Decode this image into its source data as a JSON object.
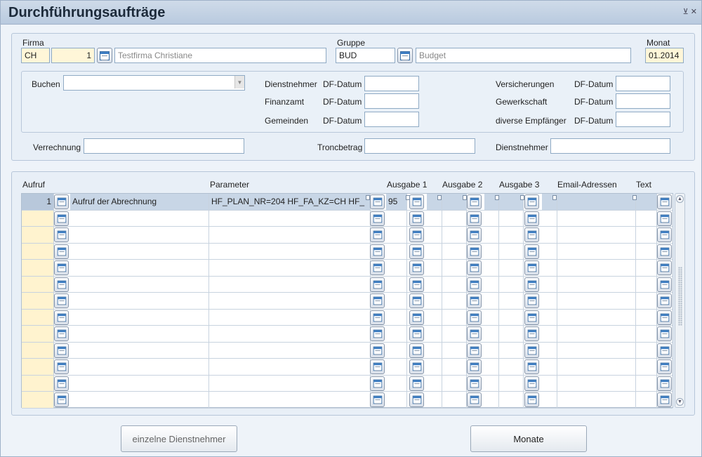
{
  "window": {
    "title": "Durchführungsaufträge",
    "controls": "⊻ ✕"
  },
  "header": {
    "firma_label": "Firma",
    "firma_code": "CH",
    "firma_number": "1",
    "firma_name": "Testfirma Christiane",
    "gruppe_label": "Gruppe",
    "gruppe_code": "BUD",
    "gruppe_name": "Budget",
    "monat_label": "Monat",
    "monat_value": "01.2014"
  },
  "buchen": {
    "label": "Buchen",
    "value": "",
    "left_group": {
      "rows": [
        {
          "label": "Dienstnehmer",
          "df": "DF-Datum",
          "value": ""
        },
        {
          "label": "Finanzamt",
          "df": "DF-Datum",
          "value": ""
        },
        {
          "label": "Gemeinden",
          "df": "DF-Datum",
          "value": ""
        }
      ]
    },
    "right_group": {
      "rows": [
        {
          "label": "Versicherungen",
          "df": "DF-Datum",
          "value": ""
        },
        {
          "label": "Gewerkschaft",
          "df": "DF-Datum",
          "value": ""
        },
        {
          "label": "diverse Empfänger",
          "df": "DF-Datum",
          "value": ""
        }
      ]
    }
  },
  "bottom_fields": {
    "verrechnung_label": "Verrechnung",
    "verrechnung_value": "",
    "tronc_label": "Troncbetrag",
    "tronc_value": "",
    "dn_label": "Dienstnehmer",
    "dn_value": ""
  },
  "table": {
    "columns": [
      "Aufruf",
      "Parameter",
      "Ausgabe 1",
      "Ausgabe 2",
      "Ausgabe 3",
      "Email-Adressen",
      "Text"
    ],
    "rows": [
      {
        "aufruf": "1",
        "name": "Aufruf der Abrechnung",
        "parameter": "HF_PLAN_NR=204 HF_FA_KZ=CH HF_",
        "ausgabe1": "95",
        "selected": true
      },
      {
        "aufruf": "",
        "name": "",
        "parameter": "",
        "ausgabe1": ""
      },
      {
        "aufruf": "",
        "name": "",
        "parameter": "",
        "ausgabe1": ""
      },
      {
        "aufruf": "",
        "name": "",
        "parameter": "",
        "ausgabe1": ""
      },
      {
        "aufruf": "",
        "name": "",
        "parameter": "",
        "ausgabe1": ""
      },
      {
        "aufruf": "",
        "name": "",
        "parameter": "",
        "ausgabe1": ""
      },
      {
        "aufruf": "",
        "name": "",
        "parameter": "",
        "ausgabe1": ""
      },
      {
        "aufruf": "",
        "name": "",
        "parameter": "",
        "ausgabe1": ""
      },
      {
        "aufruf": "",
        "name": "",
        "parameter": "",
        "ausgabe1": ""
      },
      {
        "aufruf": "",
        "name": "",
        "parameter": "",
        "ausgabe1": ""
      },
      {
        "aufruf": "",
        "name": "",
        "parameter": "",
        "ausgabe1": ""
      },
      {
        "aufruf": "",
        "name": "",
        "parameter": "",
        "ausgabe1": ""
      },
      {
        "aufruf": "",
        "name": "",
        "parameter": "",
        "ausgabe1": ""
      }
    ]
  },
  "buttons": {
    "einzelne": "einzelne Dienstnehmer",
    "monate": "Monate"
  },
  "icons": {
    "lookup": "calendar-list-icon"
  }
}
